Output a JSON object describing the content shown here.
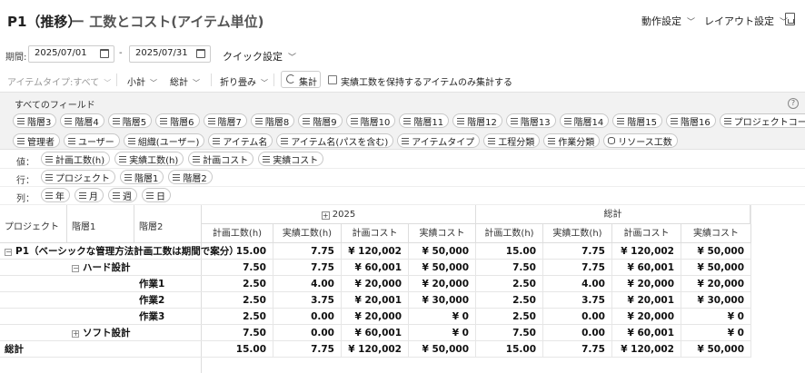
{
  "header": {
    "title": "P1（推移）",
    "subtitle": "ー 工数とコスト(アイテム単位)",
    "action_settings": "動作設定",
    "layout_settings": "レイアウト設定"
  },
  "filters": {
    "period_label": "期間:",
    "start_date": "2025/07/01",
    "separator": "-",
    "end_date": "2025/07/31",
    "quick_settings": "クイック設定"
  },
  "options": {
    "item_type": "アイテムタイプ:すべて",
    "subtotal": "小計",
    "grand_total": "総計",
    "collapse": "折り畳み",
    "aggregate": "集計",
    "checkbox_label": "実績工数を保持するアイテムのみ集計する",
    "checkbox_checked": false
  },
  "fields_panel": {
    "title": "すべてのフィールド",
    "fields": [
      "階層3",
      "階層4",
      "階層5",
      "階層6",
      "階層7",
      "階層8",
      "階層9",
      "階層10",
      "階層11",
      "階層12",
      "階層13",
      "階層14",
      "階層15",
      "階層16",
      "プロジェクトコード",
      "管理者",
      "ユーザー",
      "組織(ユーザー)",
      "アイテム名",
      "アイテム名(パスを含む)",
      "アイテムタイプ",
      "工程分類",
      "作業分類",
      "リソース工数"
    ]
  },
  "zones": {
    "values_label": "値：",
    "values": [
      "計画工数(h)",
      "実績工数(h)",
      "計画コスト",
      "実績コスト"
    ],
    "rows_label": "行：",
    "rows": [
      "プロジェクト",
      "階層1",
      "階層2"
    ],
    "cols_label": "列：",
    "cols": [
      "年",
      "月",
      "週",
      "日"
    ]
  },
  "pivot": {
    "row_headers": [
      "プロジェクト",
      "階層1",
      "階層2"
    ],
    "year": "2025",
    "total_header": "総計",
    "measures": [
      "計画工数(h)",
      "実績工数(h)",
      "計画コスト",
      "実績コスト"
    ],
    "rows": [
      {
        "label": "P1（ベーシックな管理方法計画工数は期間で案分）",
        "level": 0,
        "toggle": "−",
        "values": [
          "15.00",
          "7.75",
          "¥ 120,002",
          "¥ 50,000",
          "15.00",
          "7.75",
          "¥ 120,002",
          "¥ 50,000"
        ]
      },
      {
        "label": "ハード設計",
        "level": 1,
        "toggle": "−",
        "values": [
          "7.50",
          "7.75",
          "¥ 60,001",
          "¥ 50,000",
          "7.50",
          "7.75",
          "¥ 60,001",
          "¥ 50,000"
        ]
      },
      {
        "label": "作業1",
        "level": 2,
        "toggle": "",
        "values": [
          "2.50",
          "4.00",
          "¥ 20,000",
          "¥ 20,000",
          "2.50",
          "4.00",
          "¥ 20,000",
          "¥ 20,000"
        ]
      },
      {
        "label": "作業2",
        "level": 2,
        "toggle": "",
        "values": [
          "2.50",
          "3.75",
          "¥ 20,001",
          "¥ 30,000",
          "2.50",
          "3.75",
          "¥ 20,001",
          "¥ 30,000"
        ]
      },
      {
        "label": "作業3",
        "level": 2,
        "toggle": "",
        "values": [
          "2.50",
          "0.00",
          "¥ 20,000",
          "¥ 0",
          "2.50",
          "0.00",
          "¥ 20,000",
          "¥ 0"
        ]
      },
      {
        "label": "ソフト設計",
        "level": 1,
        "toggle": "+",
        "values": [
          "7.50",
          "0.00",
          "¥ 60,001",
          "¥ 0",
          "7.50",
          "0.00",
          "¥ 60,001",
          "¥ 0"
        ]
      },
      {
        "label": "総計",
        "level": -1,
        "toggle": "",
        "values": [
          "15.00",
          "7.75",
          "¥ 120,002",
          "¥ 50,000",
          "15.00",
          "7.75",
          "¥ 120,002",
          "¥ 50,000"
        ]
      }
    ]
  }
}
